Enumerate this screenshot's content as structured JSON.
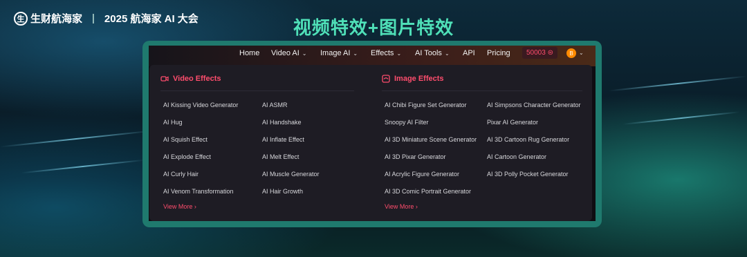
{
  "brand": {
    "logo_glyph": "生",
    "name": "生财航海家",
    "separator": "|",
    "event": "2025 航海家 AI 大会"
  },
  "headline": "视频特效+图片特效",
  "nav": {
    "home": "Home",
    "video_ai": "Video AI",
    "image_ai": "Image AI",
    "effects": "Effects",
    "ai_tools": "AI Tools",
    "api": "API",
    "pricing": "Pricing",
    "credits": "50003",
    "avatar": "B",
    "chevron": "⌄"
  },
  "video_effects": {
    "title": "Video Effects",
    "col1": [
      "AI Kissing Video Generator",
      "AI Hug",
      "AI Squish Effect",
      "AI Explode Effect",
      "AI Curly Hair",
      "AI Venom Transformation"
    ],
    "col2": [
      "AI ASMR",
      "AI Handshake",
      "AI Inflate Effect",
      "AI Melt Effect",
      "AI Muscle Generator",
      "AI Hair Growth"
    ],
    "view_more": "View More  ›"
  },
  "image_effects": {
    "title": "Image Effects",
    "col1": [
      "AI Chibi Figure Set Generator",
      "Snoopy AI Filter",
      "AI 3D Miniature Scene Generator",
      "AI 3D Pixar Generator",
      "AI Acrylic Figure Generator",
      "AI 3D Comic Portrait Generator"
    ],
    "col2": [
      "AI Simpsons Character Generator",
      "Pixar AI Generator",
      "AI 3D Cartoon Rug Generator",
      "AI Cartoon Generator",
      "AI 3D Polly Pocket Generator"
    ],
    "view_more": "View More  ›"
  },
  "colors": {
    "accent": "#ff4d6d",
    "headline": "#4fe0b8",
    "frame": "#1f7a6e"
  }
}
